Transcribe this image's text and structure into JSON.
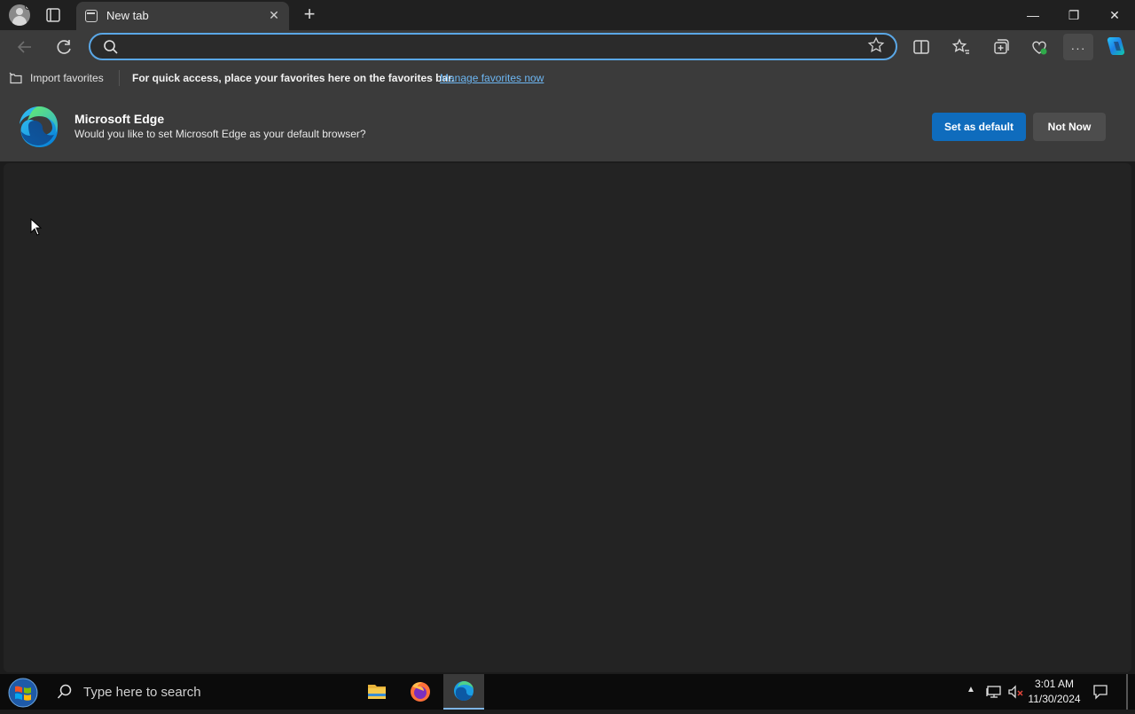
{
  "tab": {
    "title": "New tab",
    "close_glyph": "✕"
  },
  "new_tab_glyph": "+",
  "window_controls": {
    "minimize": "—",
    "restore": "❐",
    "close": "✕"
  },
  "omnibox": {
    "value": "",
    "placeholder": ""
  },
  "toolbar": {
    "more_glyph": "···"
  },
  "favorites_bar": {
    "import_label": "Import favorites",
    "message": "For quick access, place your favorites here on the favorites bar.",
    "link": "Manage favorites now"
  },
  "infobar": {
    "title": "Microsoft Edge",
    "message": "Would you like to set Microsoft Edge as your default browser?",
    "primary_button": "Set as default",
    "secondary_button": "Not Now"
  },
  "taskbar": {
    "search_placeholder": "Type here to search",
    "time": "3:01 AM",
    "date": "11/30/2024",
    "tray_arrow": "▲"
  },
  "colors": {
    "accent": "#0f6cbd",
    "link": "#6db6f2",
    "omnibox_focus": "#5aa7e6"
  },
  "icons": [
    "profile-icon",
    "tab-actions-icon",
    "back-arrow-icon",
    "refresh-icon",
    "search-icon",
    "star-icon",
    "split-screen-icon",
    "favorites-icon",
    "collections-icon",
    "browser-essentials-icon",
    "more-icon",
    "copilot-icon",
    "edge-logo-icon",
    "windows-start-icon",
    "file-explorer-icon",
    "firefox-icon",
    "edge-taskbar-icon",
    "network-icon",
    "volume-muted-icon",
    "notifications-icon"
  ]
}
